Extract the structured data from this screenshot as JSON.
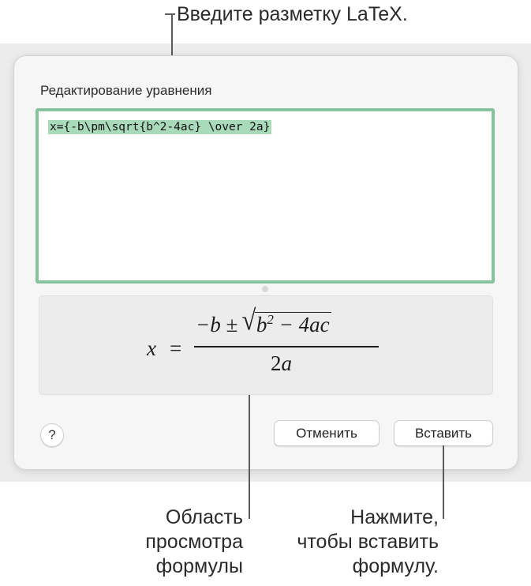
{
  "callouts": {
    "latex_input": "Введите разметку LaTeX.",
    "preview_area_lines": [
      "Область",
      "просмотра",
      "формулы"
    ],
    "insert_lines": [
      "Нажмите,",
      "чтобы вставить",
      "формулу."
    ]
  },
  "dialog": {
    "title": "Редактирование уравнения",
    "latex_text": "x={-b\\pm\\sqrt{b^2-4ac} \\over 2a}",
    "preview": {
      "lhs": "x",
      "equals": "=",
      "numerator_prefix": "−b ± ",
      "sqrt_symbol": "√",
      "radicand_base": "b",
      "radicand_exp": "2",
      "radicand_rest": " − 4ac",
      "denominator_coef": "2",
      "denominator_var": "a"
    },
    "help_label": "?",
    "cancel_label": "Отменить",
    "insert_label": "Вставить"
  },
  "colors": {
    "editor_border": "#85c49c",
    "selection": "#a9dbbb"
  }
}
